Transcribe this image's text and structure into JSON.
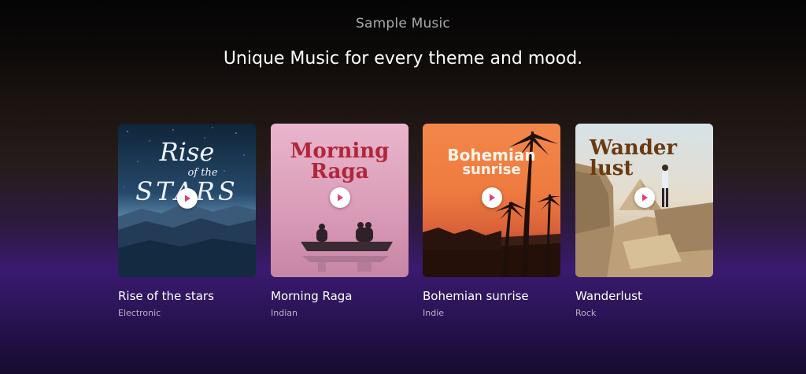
{
  "section": {
    "eyebrow": "Sample Music",
    "headline": "Unique Music for every theme and mood."
  },
  "tracks": [
    {
      "cover_text_1": "Rise",
      "cover_text_2": "of the",
      "cover_text_3": "STARS",
      "name": "Rise of the stars",
      "genre": "Electronic"
    },
    {
      "cover_text_1": "Morning",
      "cover_text_2": "Raga",
      "name": "Morning Raga",
      "genre": "Indian"
    },
    {
      "cover_text_1": "Bohemian",
      "cover_text_2": "sunrise",
      "name": "Bohemian sunrise",
      "genre": "Indie"
    },
    {
      "cover_text_1": "Wander",
      "cover_text_2": "lust",
      "name": "Wanderlust",
      "genre": "Rock"
    }
  ],
  "colors": {
    "play_accent": "#e0407a",
    "raga_title": "#b0263b",
    "wander_title": "#6a3a12"
  },
  "icons": {
    "play": "play-icon"
  }
}
